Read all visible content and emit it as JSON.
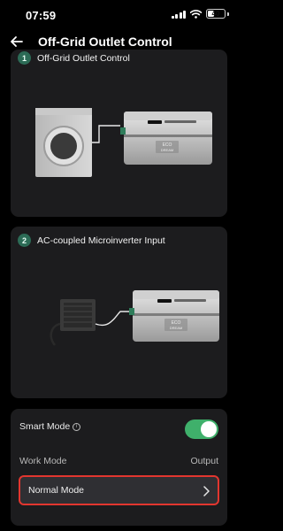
{
  "status_bar": {
    "time": "07:59",
    "battery_level": "40",
    "battery_fraction": 0.4,
    "icons": [
      "signal-icon",
      "wifi-icon",
      "battery-icon"
    ]
  },
  "header": {
    "title": "Off-Grid Outlet Control",
    "back_icon": "back-arrow-icon"
  },
  "cards": [
    {
      "number": "1",
      "label": "Off-Grid Outlet Control",
      "device_label": "ECO\nDREAM"
    },
    {
      "number": "2",
      "label": "AC-coupled Microinverter Input",
      "device_label": "ECO\nDREAM"
    }
  ],
  "settings": {
    "smart_mode_label": "Smart Mode",
    "smart_mode_on": true,
    "work_mode_label": "Work Mode",
    "work_mode_value": "Output",
    "selected_mode": "Normal Mode"
  },
  "colors": {
    "background": "#000000",
    "card": "#1c1c1e",
    "accent_green": "#3fb06b",
    "highlight_red": "#e2362f"
  }
}
